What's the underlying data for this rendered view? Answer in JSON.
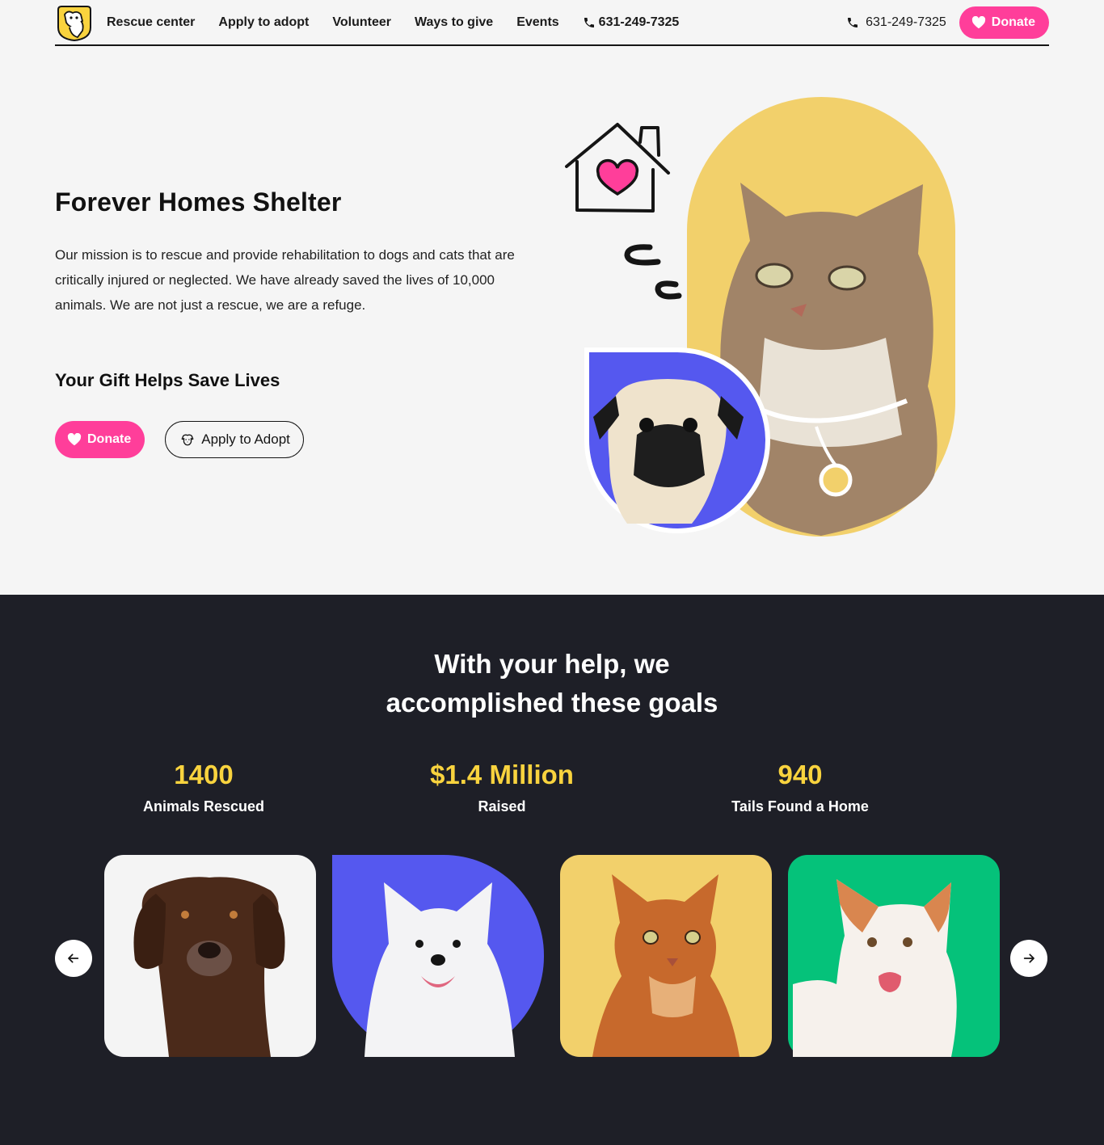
{
  "nav": {
    "links": [
      "Rescue center",
      "Apply to adopt",
      "Volunteer",
      "Ways to give",
      "Events"
    ],
    "phone": "631-249-7325"
  },
  "header": {
    "phone": "631-249-7325",
    "donate_label": "Donate"
  },
  "hero": {
    "title": "Forever Homes Shelter",
    "text": "Our mission is to rescue and provide rehabilitation to dogs and cats that are critically injured or neglected. We have already saved the lives of 10,000 animals. We are not just a rescue, we are a refuge.",
    "subtitle": "Your Gift Helps Save Lives",
    "donate_label": "Donate",
    "adopt_label": "Apply to Adopt"
  },
  "stats": {
    "title_line1": "With your help, we",
    "title_line2": "accomplished these goals",
    "items": [
      {
        "value": "1400",
        "label": "Animals Rescued"
      },
      {
        "value": "$1.4 Million",
        "label": "Raised"
      },
      {
        "value": "940",
        "label": "Tails Found a Home"
      }
    ]
  },
  "colors": {
    "accent_pink": "#ff3e9a",
    "dark_bg": "#1e1f27",
    "stat_yellow": "#f9d33e",
    "card_yellow": "#f2d06b",
    "card_blue": "#5558ef",
    "card_green": "#05c27a"
  },
  "icons": {
    "logo": "dog-cat-logo-icon",
    "phone": "phone-icon",
    "heart": "heart-icon",
    "paw": "dog-face-icon",
    "prev": "arrow-left-icon",
    "next": "arrow-right-icon"
  }
}
